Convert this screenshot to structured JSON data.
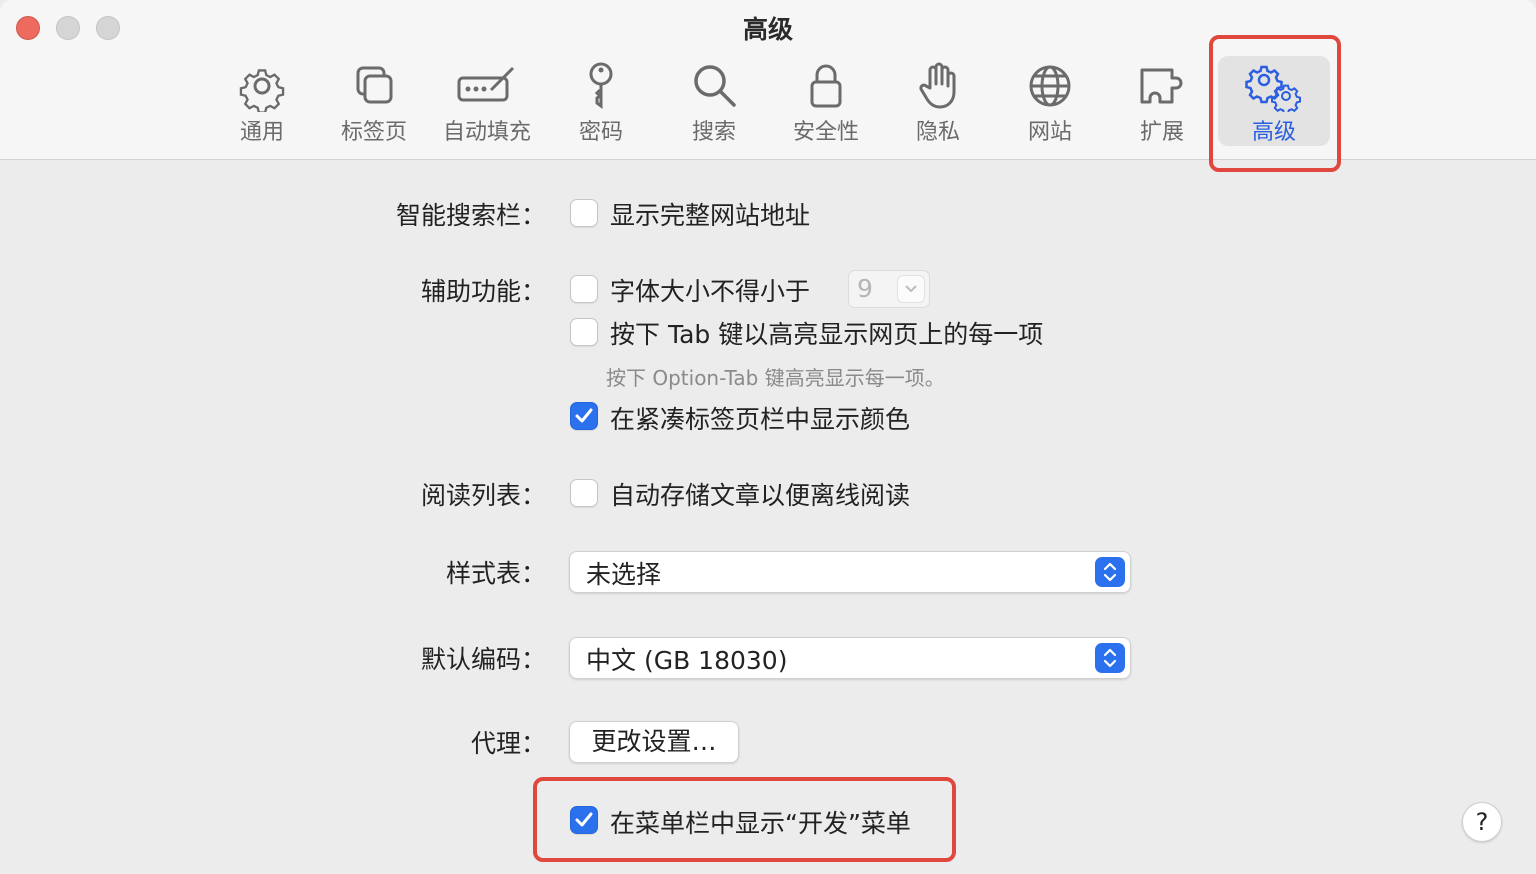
{
  "window": {
    "title": "高级"
  },
  "toolbar": {
    "tabs": [
      {
        "label": "通用",
        "icon": "gear-icon"
      },
      {
        "label": "标签页",
        "icon": "tabs-icon"
      },
      {
        "label": "自动填充",
        "icon": "autofill-icon"
      },
      {
        "label": "密码",
        "icon": "key-icon"
      },
      {
        "label": "搜索",
        "icon": "search-icon"
      },
      {
        "label": "安全性",
        "icon": "lock-icon"
      },
      {
        "label": "隐私",
        "icon": "hand-icon"
      },
      {
        "label": "网站",
        "icon": "globe-icon"
      },
      {
        "label": "扩展",
        "icon": "puzzle-icon"
      },
      {
        "label": "高级",
        "icon": "gears-icon",
        "selected": true
      }
    ]
  },
  "settings": {
    "smart_search": {
      "label": "智能搜索栏：",
      "show_full_address": {
        "text": "显示完整网站地址",
        "checked": false
      }
    },
    "accessibility": {
      "label": "辅助功能：",
      "min_font": {
        "text": "字体大小不得小于",
        "checked": false,
        "value": "9"
      },
      "tab_highlight": {
        "text": "按下 Tab 键以高亮显示网页上的每一项",
        "checked": false
      },
      "tab_hint": "按下 Option-Tab 键高亮显示每一项。",
      "compact_color": {
        "text": "在紧凑标签页栏中显示颜色",
        "checked": true
      }
    },
    "reading_list": {
      "label": "阅读列表：",
      "save_offline": {
        "text": "自动存储文章以便离线阅读",
        "checked": false
      }
    },
    "stylesheet": {
      "label": "样式表：",
      "value": "未选择"
    },
    "encoding": {
      "label": "默认编码：",
      "value": "中文 (GB 18030)"
    },
    "proxy": {
      "label": "代理：",
      "button": "更改设置…"
    },
    "develop_menu": {
      "text": "在菜单栏中显示“开发”菜单",
      "checked": true
    },
    "help": "?"
  },
  "colors": {
    "accent": "#2b71ee",
    "selected_tab_text": "#2b5ee0",
    "annotation_red": "#e0483e"
  }
}
